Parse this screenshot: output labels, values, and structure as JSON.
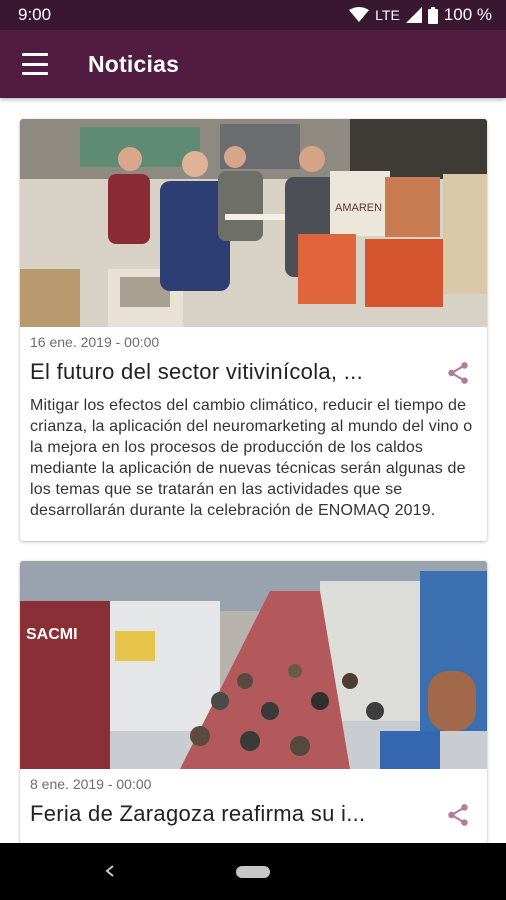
{
  "status_bar": {
    "time": "9:00",
    "network": "LTE",
    "battery": "100 %"
  },
  "app_bar": {
    "title": "Noticias",
    "menu_icon": "hamburger-menu-icon"
  },
  "articles": [
    {
      "date": "16 ene. 2019 - 00:00",
      "title": "El futuro del sector vitivinícola, ...",
      "summary": "Mitigar los efectos del cambio climático, reducir el tiempo de crianza, la aplicación del neuromarketing al mundo del vino o la mejora en los procesos de producción de los caldos mediante la aplicación de nuevas técnicas serán algunas de los temas que se tratarán en las actividades que se desarrollarán durante la celebración de ENOMAQ 2019.",
      "image_text": "AMAREN",
      "share_icon": "share-icon"
    },
    {
      "date": "8 ene. 2019 - 00:00",
      "title": "Feria de Zaragoza reafirma su i...",
      "image_text": "SACMI",
      "share_icon": "share-icon"
    }
  ],
  "colors": {
    "status_bar": "#3a1730",
    "app_bar": "#521c42",
    "share_icon": "#b57a9e"
  },
  "nav_bar": {
    "back_icon": "back-chevron-icon",
    "home_icon": "home-pill-icon"
  }
}
